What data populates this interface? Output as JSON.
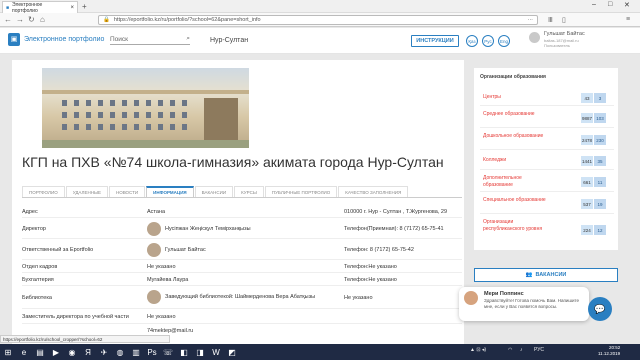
{
  "browser": {
    "tab_title": "Электронное портфолио",
    "url": "https://eportfolio.kz/ru/portfolio/?school=62&pane=short_info",
    "new_tab": "+",
    "tab_close": "×",
    "dots": "···"
  },
  "header": {
    "logo_text": "Электронное портфолио",
    "search_placeholder": "Поиск",
    "city": "Нур-Султан",
    "instructions_label": "ИНСТРУКЦИИ",
    "langs": [
      "Қаз",
      "Рус",
      "Eng"
    ],
    "user_name": "Гульшат Байтас",
    "user_email": "baitas-187@mail.ru",
    "user_role": "Пользователь"
  },
  "school": {
    "title": "КГП на ПХВ «№74 школа-гимназия» акимата города Нур-Султан"
  },
  "tabs": [
    "ПОРТФОЛИО",
    "УДАЛЕННЫЕ",
    "НОВОСТИ",
    "ИНФОРМАЦИЯ",
    "ВАКАНСИИ",
    "КУРСЫ",
    "ПУБЛИЧНЫЕ ПОРТФОЛИО",
    "КАЧЕСТВО ЗАПОЛНЕНИЯ"
  ],
  "active_tab": "ИНФОРМАЦИЯ",
  "info": [
    {
      "label": "Адрес",
      "value": "Астана",
      "value2": "010000 г. Нур - Султан , Т.Жургенова, 29"
    },
    {
      "label": "Директор",
      "value": "Нусіпжан Жеңісқүл Темірханқызы",
      "value2": "Телефон(Приемная): 8 (7172) 65-75-41"
    },
    {
      "label": "Ответственный за Eportfolio",
      "value": "Гульшат Байтас",
      "value2": "Телефон: 8 (7172) 65-75-42"
    },
    {
      "label": "Отдел кадров",
      "value": "Не указано",
      "value2": "Телефон:Не указано"
    },
    {
      "label": "Бухгалтерия",
      "value": "Мугайева Лаура",
      "value2": "Телефон:Не указано"
    },
    {
      "label": "Библиотека",
      "value": "Заведующий библиотекой: Шаймерденова Вера Абатқызы",
      "value2": "Не указано"
    },
    {
      "label": "Заместитель директора по учебной части",
      "value": "Не указано",
      "value2": ""
    },
    {
      "label": "",
      "value": "74mektep@mail.ru",
      "value2": ""
    }
  ],
  "sidebar": {
    "title": "Организации образования",
    "rows": [
      {
        "name": "Центры",
        "c1": "43",
        "c2": "3"
      },
      {
        "name": "Среднее образование",
        "c1": "9887",
        "c2": "103"
      },
      {
        "name": "Дошкольное образование",
        "c1": "2478",
        "c2": "230"
      },
      {
        "name": "Колледжи",
        "c1": "1441",
        "c2": "35"
      },
      {
        "name": "Дополнительное образование",
        "c1": "661",
        "c2": "11"
      },
      {
        "name": "Специальное образование",
        "c1": "537",
        "c2": "19"
      },
      {
        "name": "Организации республиканского уровня",
        "c1": "224",
        "c2": "12"
      }
    ],
    "vacancy_label": "ВАКАНСИИ"
  },
  "chat": {
    "name": "Мери Поппинс",
    "message": "Здравствуйте! Готова помочь Вам. Напишите мне, если у Вас появятся вопросы."
  },
  "status_bar": "https://eportfolio.kz/ru/school_cropper/?school=62",
  "taskbar": {
    "tray_lang": "РУС",
    "time": "20:52",
    "date": "11.12.2019"
  },
  "colors": {
    "accent": "#2a7fc1",
    "sidebar_red": "#e53935"
  }
}
